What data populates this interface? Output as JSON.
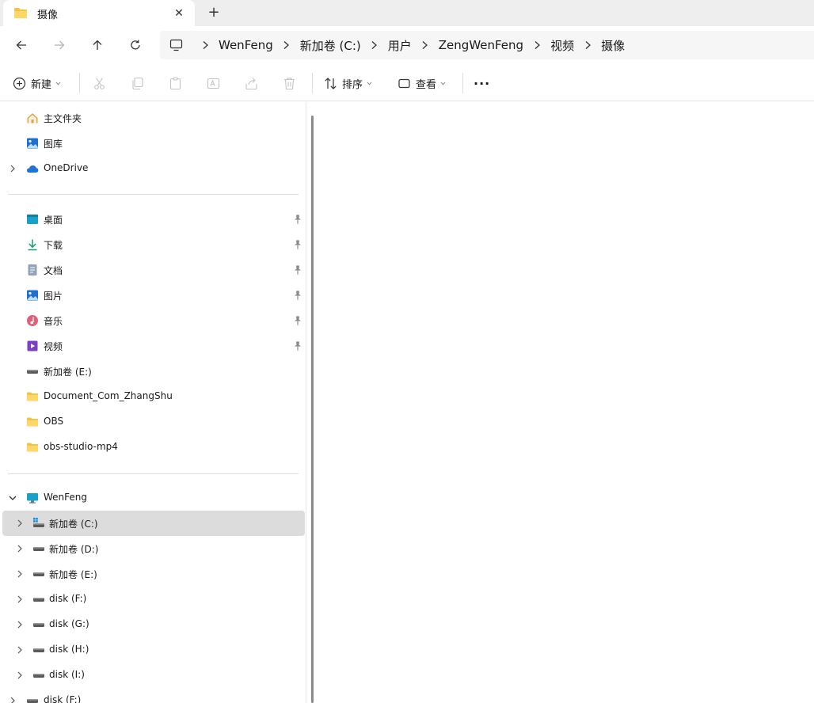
{
  "tab": {
    "title": "摄像",
    "close_glyph": "✕",
    "new_glyph": "+"
  },
  "breadcrumb": [
    "WenFeng",
    "新加卷 (C:)",
    "用户",
    "ZengWenFeng",
    "视频",
    "摄像"
  ],
  "commands": {
    "new_label": "新建",
    "sort_label": "排序",
    "view_label": "查看",
    "more_glyph": "···"
  },
  "sidebar": {
    "quick": [
      {
        "label": "主文件夹",
        "icon": "home-icon"
      },
      {
        "label": "图库",
        "icon": "gallery-icon"
      },
      {
        "label": "OneDrive",
        "icon": "cloud-icon"
      }
    ],
    "pinned": [
      {
        "label": "桌面",
        "icon": "desktop-icon"
      },
      {
        "label": "下载",
        "icon": "download-icon"
      },
      {
        "label": "文档",
        "icon": "document-icon"
      },
      {
        "label": "图片",
        "icon": "pictures-icon"
      },
      {
        "label": "音乐",
        "icon": "music-icon"
      },
      {
        "label": "视频",
        "icon": "videos-icon"
      },
      {
        "label": "新加卷 (E:)",
        "icon": "drive-icon"
      },
      {
        "label": "Document_Com_ZhangShu",
        "icon": "folder-icon"
      },
      {
        "label": "OBS",
        "icon": "folder-icon"
      },
      {
        "label": "obs-studio-mp4",
        "icon": "folder-icon"
      }
    ],
    "pc": {
      "label": "WenFeng",
      "drives": [
        "新加卷 (C:)",
        "新加卷 (D:)",
        "新加卷 (E:)",
        "disk (F:)",
        "disk (G:)",
        "disk (H:)",
        "disk (I:)"
      ],
      "extra": "disk (F:)"
    }
  },
  "colors": {
    "folder": "#f5c242",
    "onedrive": "#1e73d4",
    "selected_row": "#dcdcdc",
    "accent": "#0067c0"
  }
}
